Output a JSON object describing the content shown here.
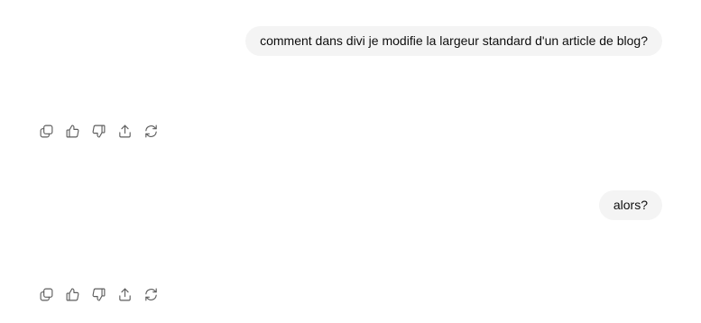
{
  "conversation": {
    "messages": [
      {
        "role": "user",
        "text": "comment dans divi je modifie la largeur standard d'un article de blog?"
      },
      {
        "role": "user",
        "text": "alors?"
      }
    ]
  },
  "assistant_actions": {
    "icons": [
      "copy-icon",
      "thumbs-up-icon",
      "thumbs-down-icon",
      "share-icon",
      "regenerate-icon"
    ]
  },
  "colors": {
    "bubble_background": "#f4f4f4",
    "icon_color": "#5d5d5d",
    "text_color": "#0d0d0d"
  }
}
